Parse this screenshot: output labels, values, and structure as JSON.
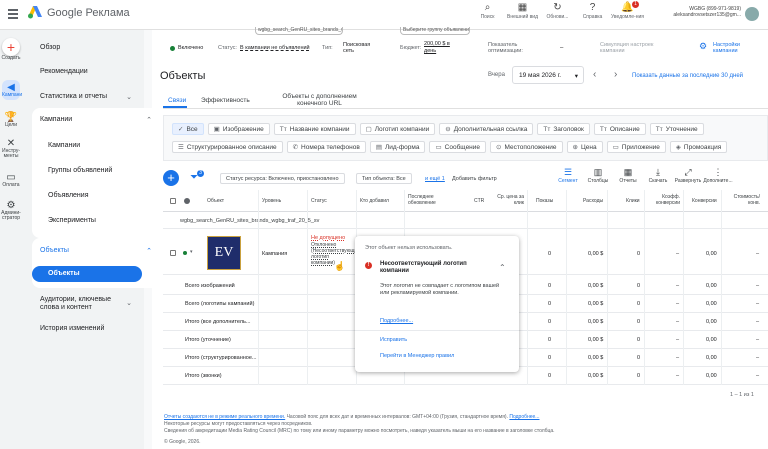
{
  "app": {
    "title": "Google Реклама"
  },
  "topbar": {
    "icons": [
      {
        "icon": "search-icon",
        "glyph": "⌕",
        "label": "Поиск"
      },
      {
        "icon": "chart-icon",
        "glyph": "▦",
        "label": "Внешний вид"
      },
      {
        "icon": "refresh-icon",
        "glyph": "↻",
        "label": "Обнови..."
      },
      {
        "icon": "help-icon",
        "glyph": "?",
        "label": "Справка"
      },
      {
        "icon": "bell-icon",
        "glyph": "🔔",
        "label": "Уведомле-ния"
      }
    ],
    "notification_count": "1",
    "account_line1": "WGBG (899-971-9819)",
    "account_line2": "aleksandrovsetszer135@gm..."
  },
  "rail": [
    {
      "icon": "plus-icon",
      "label": "Создать"
    },
    {
      "icon": "megaphone-icon",
      "label": "Кампании"
    },
    {
      "icon": "trophy-icon",
      "label": "Цели"
    },
    {
      "icon": "tools-icon",
      "label": "Инстру-менты"
    },
    {
      "icon": "billing-icon",
      "label": "Оплата"
    },
    {
      "icon": "admin-icon",
      "label": "Админи-стратор"
    }
  ],
  "sidebar": {
    "overview": "Обзор",
    "recommendations": "Рекомендации",
    "stats": "Статистика и отчеты",
    "campaigns": "Кампании",
    "campaigns_sub": [
      "Кампании",
      "Группы объявлений",
      "Объявления",
      "Эксперименты"
    ],
    "assets": "Объекты",
    "assets_active": "Объекты",
    "audiences": "Аудитории, ключевые слова и контент",
    "history": "История изменений"
  },
  "campaign_strip": {
    "tab1": "wgbg_search_GenRU_sites_brands_wgbg_traf_20_5_sv",
    "tab3": "Выберите группу объявлений",
    "status_on": "Включено",
    "status_label": "Статус:",
    "status_value": "В кампании не объявлений",
    "type_label": "Тип:",
    "type_value": "Поисковая сеть",
    "budget_label": "Бюджет:",
    "budget_value": "200,00 $ в день",
    "optimization": "Показатель оптимизации:",
    "optimization_value": "–",
    "simulate": "Симуляция настроек кампании",
    "settings": "Настройки кампании"
  },
  "page": {
    "title": "Объекты",
    "date_prefix": "Вчера",
    "date_value": "19 мая 2026 г.",
    "show_30": "Показать данные за последние 30 дней",
    "tabs": [
      "Связи",
      "Эффективность",
      "Объекты с дополнением конечного URL"
    ]
  },
  "asset_types": [
    [
      "Все",
      "Изображение",
      "Название компании",
      "Логотип компании",
      "Дополнительная ссылка",
      "Заголовок",
      "Описание",
      "Уточнение"
    ],
    [
      "Структурированное описание",
      "Номера телефонов",
      "Лид-форма",
      "Сообщение",
      "Местоположение",
      "Цена",
      "Приложение",
      "Промоакция"
    ]
  ],
  "toolbar": {
    "filter_chip1": "Статус ресурса: Включено, приостановлено",
    "filter_chip2": "Тип объекта: Все",
    "and_more": "и ещё 1",
    "add_filter": "Добавить фильтр",
    "filter_count": "3",
    "actions": [
      {
        "icon": "segment-icon",
        "label": "Сегмент"
      },
      {
        "icon": "columns-icon",
        "label": "Столбцы"
      },
      {
        "icon": "reports-icon",
        "label": "Отчеты"
      },
      {
        "icon": "download-icon",
        "label": "Скачать"
      },
      {
        "icon": "expand-icon",
        "label": "Развернуть"
      },
      {
        "icon": "more-icon",
        "label": "Дополните..."
      }
    ]
  },
  "table": {
    "headers": [
      "Объект",
      "Уровень",
      "Статус",
      "Кто добавил",
      "Последнее обновление",
      "CTR",
      "Ср. цена за клик",
      "Показы",
      "Расходы",
      "Клики",
      "Коэфф. конверсии",
      "Конверсии",
      "Стоимость/ конв."
    ],
    "campaign_name": "wgbg_search_GenRU_sites_brands_wgbg_traf_20_5_sv",
    "asset_row": {
      "logo": "EV",
      "level": "Кампания",
      "status_bad": "Не допущено",
      "status_sub": "Отклонено (Несоответствующий логотип компании)",
      "ctr": "–",
      "cpc": "–",
      "impr": "0",
      "cost": "0,00 $",
      "clicks": "0",
      "convrate": "–",
      "conv": "0,00",
      "costconv": "–"
    },
    "totals": [
      {
        "label": "Всего изображений",
        "impr": "0",
        "cost": "0,00 $",
        "clicks": "0",
        "convrate": "–",
        "conv": "0,00",
        "costconv": "–"
      },
      {
        "label": "Всего (логотипы кампаний)",
        "impr": "0",
        "cost": "0,00 $",
        "clicks": "0",
        "convrate": "–",
        "conv": "0,00",
        "costconv": "–"
      },
      {
        "label": "Итого (все дополнитель...",
        "impr": "0",
        "cost": "0,00 $",
        "clicks": "0",
        "convrate": "–",
        "conv": "0,00",
        "costconv": "–"
      },
      {
        "label": "Итого (уточнение)",
        "impr": "0",
        "cost": "0,00 $",
        "clicks": "0",
        "convrate": "–",
        "conv": "0,00",
        "costconv": "–"
      },
      {
        "label": "Итого (структурированное...",
        "impr": "0",
        "cost": "0,00 $",
        "clicks": "0",
        "convrate": "–",
        "conv": "0,00",
        "costconv": "–"
      },
      {
        "label": "Итого (звонки)",
        "impr": "0",
        "cost": "0,00 $",
        "clicks": "0",
        "convrate": "–",
        "conv": "0,00",
        "costconv": "–"
      }
    ],
    "pagination": "1 – 1 из 1"
  },
  "popup": {
    "header": "Этот объект нельзя использовать.",
    "title": "Несоответствующий логотип компании",
    "body": "Этот логотип не совпадает с логотипом вашей или рекламируемой компании.",
    "more": "Подробнее...",
    "fix": "Исправить",
    "policy": "Перейти в Менеджер правил"
  },
  "footer": {
    "line1_link": "Отчеты создаются не в режиме реального времени.",
    "line1_rest": " Часовой пояс для всех дат и временных интервалов: GMT+04:00 (Грузия, стандартное время).",
    "line1_more": "Подробнее...",
    "line2": "Некоторые ресурсы могут предоставляться через посредников.",
    "line3": "Сведения об аккредитации Media Rating Council (MRC) по тому или иному параметру можно посмотреть, наведя указатель мыши на его название в заголовке столбца.",
    "line4": "© Google, 2026."
  },
  "colors": {
    "accent": "#1a73e8",
    "error": "#d93025",
    "ok": "#188038"
  }
}
